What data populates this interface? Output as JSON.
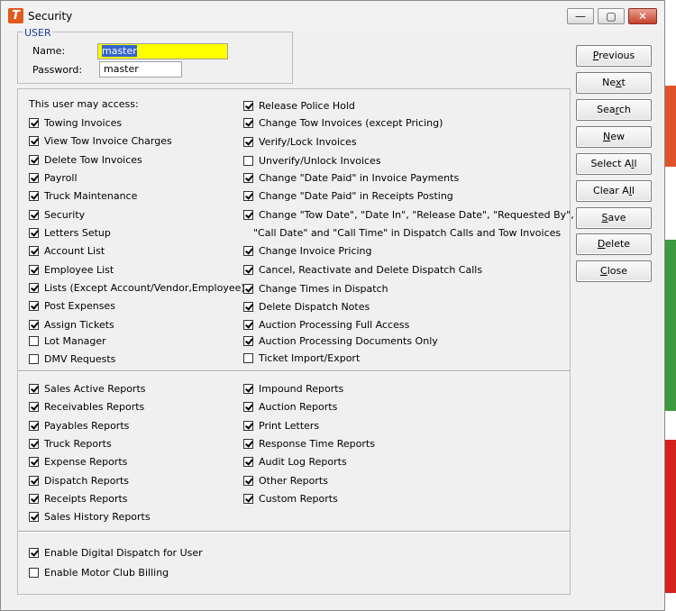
{
  "window": {
    "title": "Security",
    "app_icon_letter": "T"
  },
  "user": {
    "legend": "USER",
    "name_label": "Name:",
    "name_value": "master",
    "password_label": "Password:",
    "password_value": "master"
  },
  "access": {
    "heading": "This user may access:",
    "left": [
      {
        "label": "Towing Invoices",
        "checked": true
      },
      {
        "label": "View Tow Invoice Charges",
        "checked": true
      },
      {
        "label": "Delete Tow Invoices",
        "checked": true
      },
      {
        "label": "Payroll",
        "checked": true
      },
      {
        "label": "Truck Maintenance",
        "checked": true
      },
      {
        "label": "Security",
        "checked": true
      },
      {
        "label": "Letters Setup",
        "checked": true
      },
      {
        "label": "Account List",
        "checked": true
      },
      {
        "label": "Employee List",
        "checked": true
      },
      {
        "label": "Lists (Except Account/Vendor,Employee)",
        "checked": true
      },
      {
        "label": "Post Expenses",
        "checked": true
      },
      {
        "label": "Assign Tickets",
        "checked": true
      },
      {
        "label": "Lot Manager",
        "checked": false
      },
      {
        "label": "DMV Requests",
        "checked": false
      }
    ],
    "right": [
      {
        "label": "Release Police Hold",
        "checked": true
      },
      {
        "label": "Change Tow Invoices (except Pricing)",
        "checked": true
      },
      {
        "label": "Verify/Lock Invoices",
        "checked": true
      },
      {
        "label": "Unverify/Unlock Invoices",
        "checked": false
      },
      {
        "label": "Change \"Date Paid\" in Invoice Payments",
        "checked": true
      },
      {
        "label": "Change \"Date Paid\" in Receipts Posting",
        "checked": true
      },
      {
        "label": "Change \"Tow Date\", \"Date In\", \"Release Date\", \"Requested By\",",
        "checked": true
      },
      {
        "label": "Change Invoice Pricing",
        "checked": true
      },
      {
        "label": "Cancel, Reactivate and Delete Dispatch Calls",
        "checked": true
      },
      {
        "label": "Change Times in Dispatch",
        "checked": true
      },
      {
        "label": "Delete Dispatch Notes",
        "checked": true
      },
      {
        "label": "Auction Processing Full Access",
        "checked": true
      },
      {
        "label": "Auction Processing Documents Only",
        "checked": true
      },
      {
        "label": "Ticket Import/Export",
        "checked": false
      }
    ],
    "continuation": "\"Call Date\" and \"Call Time\"  in Dispatch Calls and Tow Invoices"
  },
  "reports": {
    "left": [
      {
        "label": "Sales Active Reports",
        "checked": true
      },
      {
        "label": "Receivables Reports",
        "checked": true
      },
      {
        "label": "Payables Reports",
        "checked": true
      },
      {
        "label": "Truck Reports",
        "checked": true
      },
      {
        "label": "Expense Reports",
        "checked": true
      },
      {
        "label": "Dispatch Reports",
        "checked": true
      },
      {
        "label": "Receipts Reports",
        "checked": true
      },
      {
        "label": "Sales History Reports",
        "checked": true
      }
    ],
    "right": [
      {
        "label": "Impound Reports",
        "checked": true
      },
      {
        "label": "Auction Reports",
        "checked": true
      },
      {
        "label": "Print Letters",
        "checked": true
      },
      {
        "label": "Response Time Reports",
        "checked": true
      },
      {
        "label": "Audit Log Reports",
        "checked": true
      },
      {
        "label": "Other Reports",
        "checked": true
      },
      {
        "label": "Custom Reports",
        "checked": true
      }
    ]
  },
  "extras": [
    {
      "label": "Enable Digital Dispatch for User",
      "checked": true
    },
    {
      "label": "Enable Motor Club Billing",
      "checked": false
    }
  ],
  "buttons": [
    {
      "key": "previous",
      "pre": "",
      "u": "P",
      "post": "revious"
    },
    {
      "key": "next",
      "pre": "Ne",
      "u": "x",
      "post": "t"
    },
    {
      "key": "search",
      "pre": "Sea",
      "u": "r",
      "post": "ch"
    },
    {
      "key": "new",
      "pre": "",
      "u": "N",
      "post": "ew"
    },
    {
      "key": "select-all",
      "pre": "Select A",
      "u": "l",
      "post": "l"
    },
    {
      "key": "clear-all",
      "pre": "Clear A",
      "u": "l",
      "post": "l"
    },
    {
      "key": "save",
      "pre": "",
      "u": "S",
      "post": "ave"
    },
    {
      "key": "delete",
      "pre": "",
      "u": "D",
      "post": "elete"
    },
    {
      "key": "close",
      "pre": "",
      "u": "C",
      "post": "lose"
    }
  ]
}
